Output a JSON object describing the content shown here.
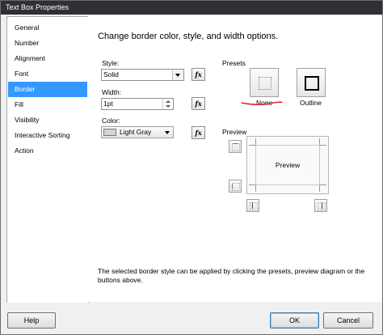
{
  "window": {
    "title": "Text Box Properties"
  },
  "sidebar": {
    "items": [
      {
        "label": "General"
      },
      {
        "label": "Number"
      },
      {
        "label": "Alignment"
      },
      {
        "label": "Font"
      },
      {
        "label": "Border",
        "selected": true
      },
      {
        "label": "Fill"
      },
      {
        "label": "Visibility"
      },
      {
        "label": "Interactive Sorting"
      },
      {
        "label": "Action"
      }
    ]
  },
  "main": {
    "heading": "Change border color, style, and width options.",
    "style": {
      "label": "Style:",
      "value": "Solid"
    },
    "width": {
      "label": "Width:",
      "value": "1pt"
    },
    "color": {
      "label": "Color:",
      "value": "Light Gray",
      "swatch": "#d3d3d3"
    },
    "fx_label": "fx",
    "presets": {
      "label": "Presets",
      "none_label": "None",
      "outline_label": "Outline"
    },
    "preview": {
      "label": "Preview",
      "text": "Preview"
    },
    "help_text": "The selected border style can be applied by clicking the presets, preview diagram or the buttons above."
  },
  "footer": {
    "help": "Help",
    "ok": "OK",
    "cancel": "Cancel"
  },
  "colors": {
    "selection": "#3399ff",
    "annotation": "#e0262b"
  }
}
